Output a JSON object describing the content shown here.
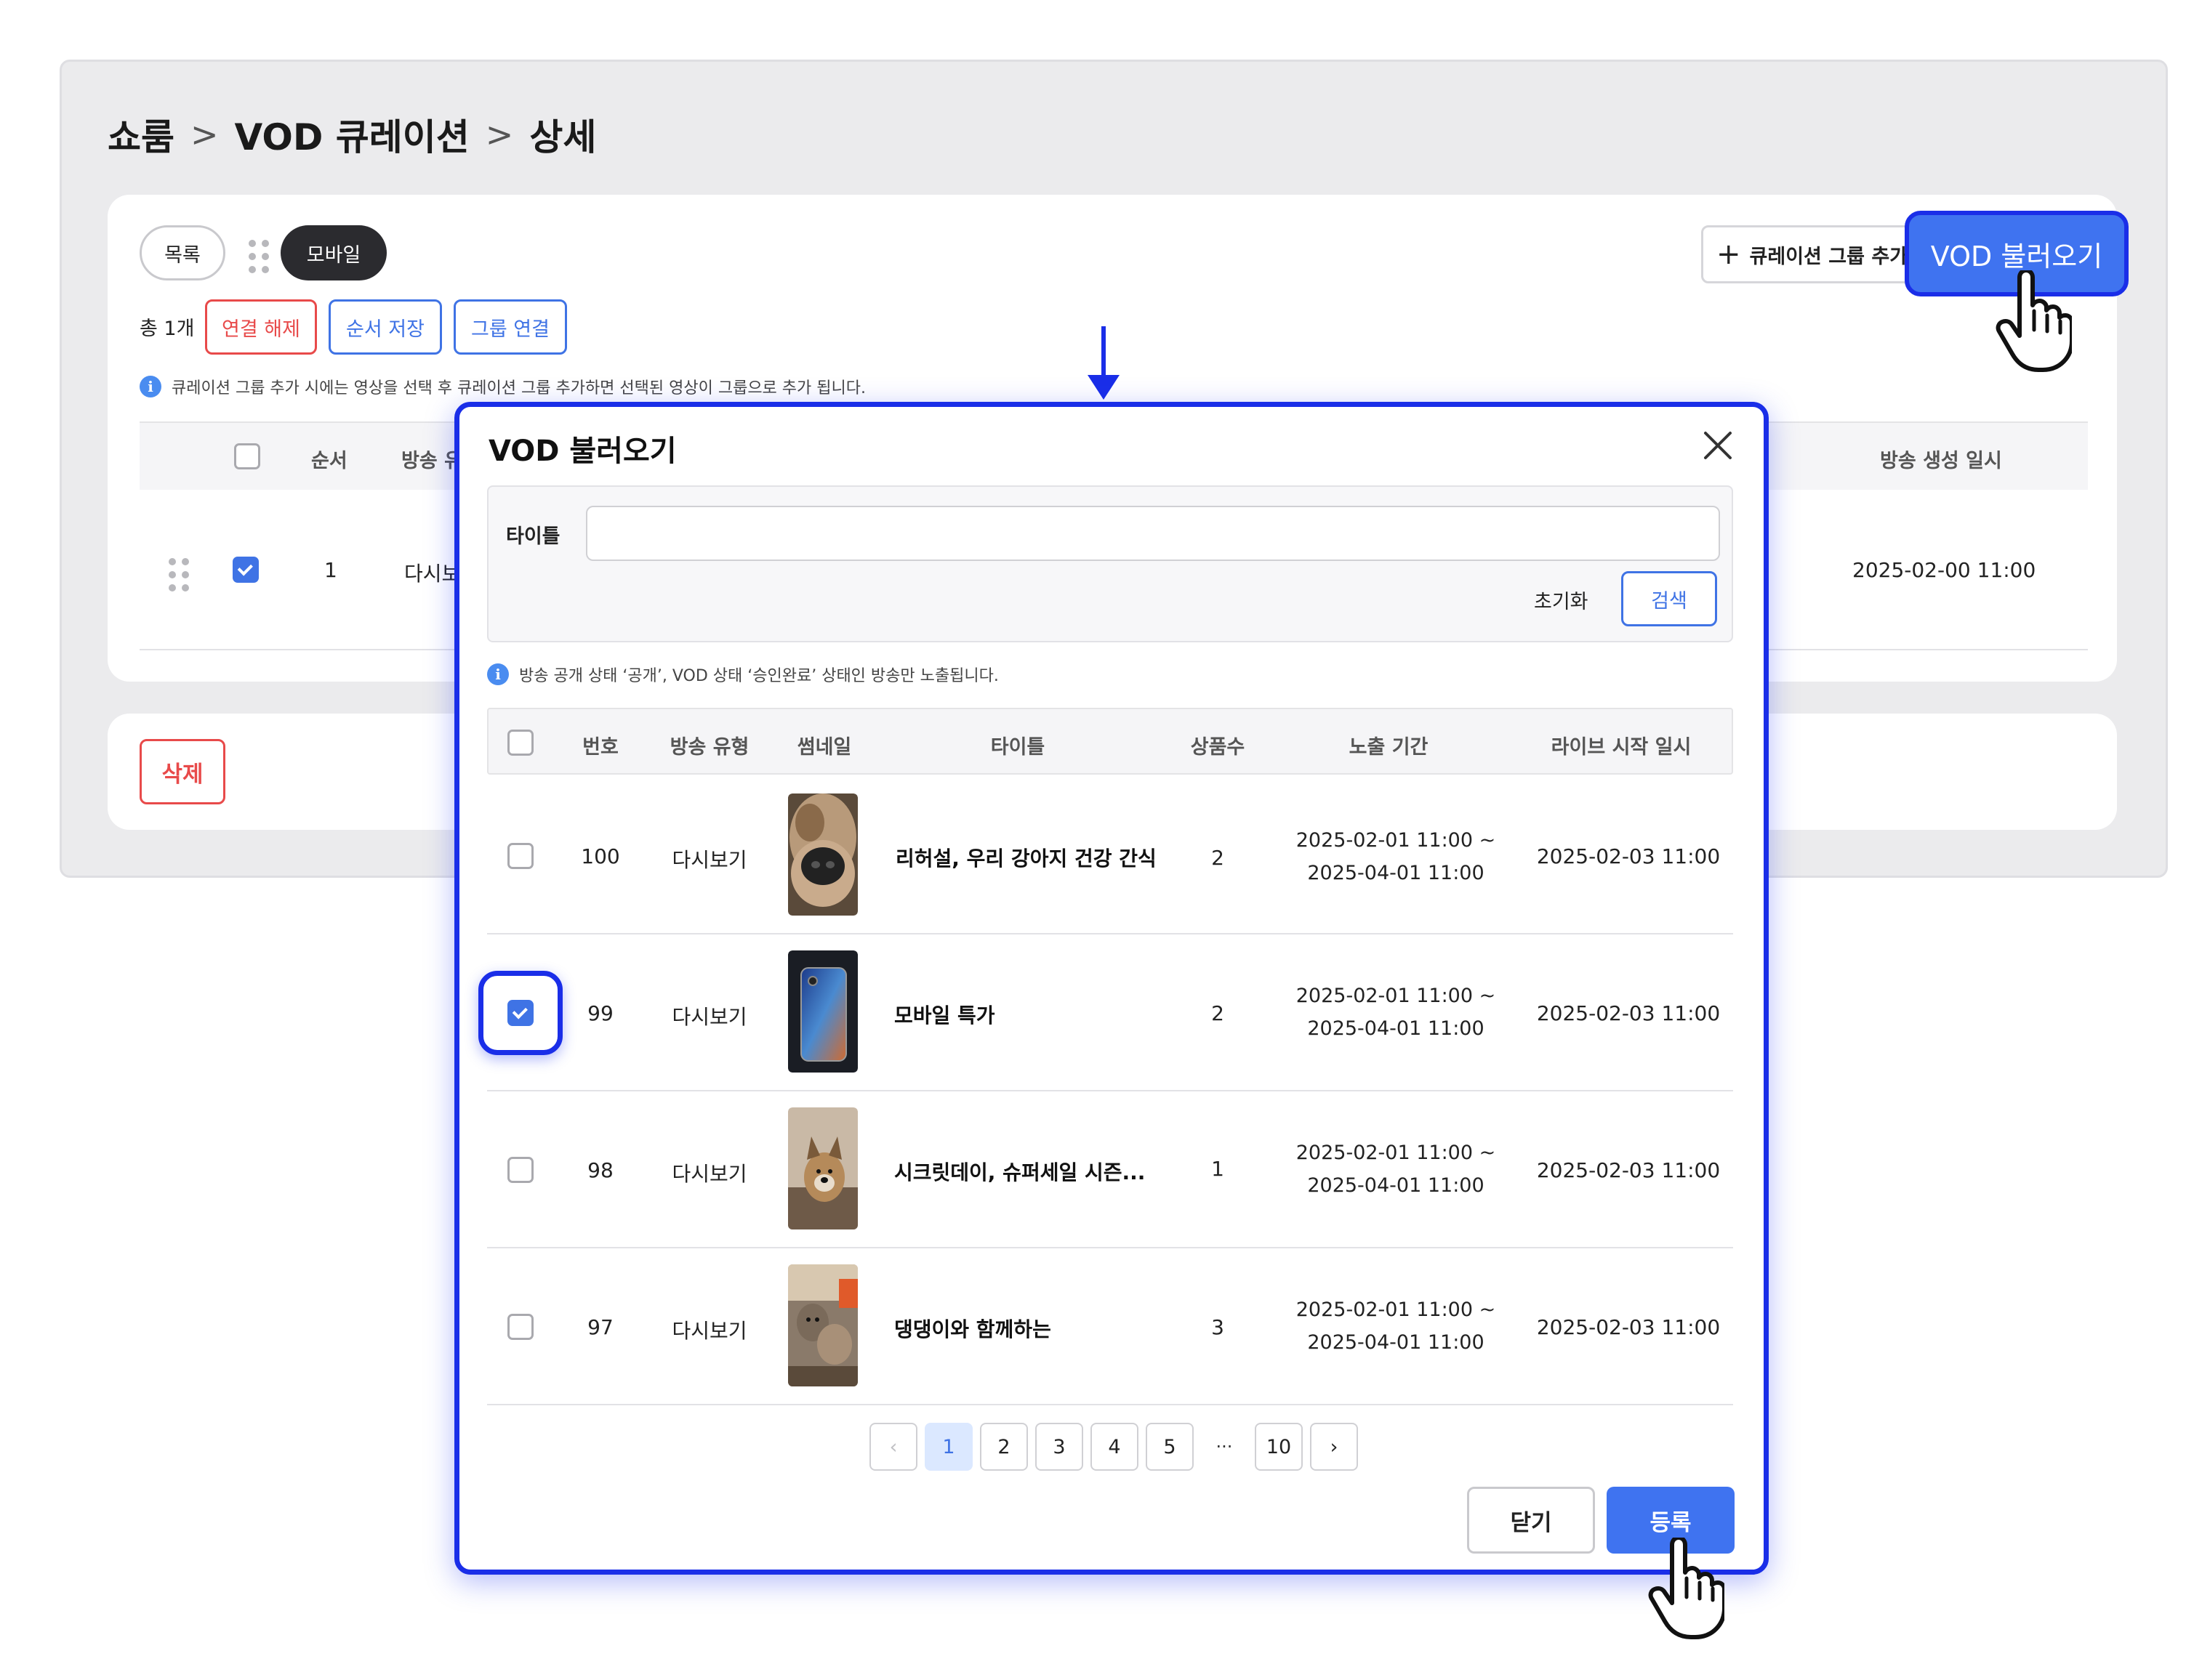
{
  "breadcrumb": {
    "items": [
      "쇼룸",
      "VOD 큐레이션",
      "상세"
    ],
    "separator": ">"
  },
  "tabs": {
    "list_label": "목록",
    "mobile_label": "모바일"
  },
  "toolbar": {
    "total": "총 1개",
    "unlink": "연결 해제",
    "save_order": "순서 저장",
    "group_link": "그룹 연결",
    "add_group": "큐레이션 그룹 추가",
    "vod_load": "VOD 불러오기"
  },
  "info": {
    "text": "큐레이션 그룹 추가 시에는 영상을 선택 후 큐레이션 그룹 추가하면 선택된 영상이 그룹으로 추가 됩니다."
  },
  "main_table": {
    "headers": {
      "order": "순서",
      "type": "방송 유",
      "created": "방송 생성 일시"
    },
    "row": {
      "order": "1",
      "type": "다시보",
      "created": "2025-02-00 11:00"
    }
  },
  "delete_button": "삭제",
  "modal": {
    "title": "VOD 불러오기",
    "search_label": "타이틀",
    "search_value": "",
    "reset": "초기화",
    "search": "검색",
    "notice": "방송 공개 상태 ‘공개’, VOD 상태 ‘승인완료’ 상태인 방송만 노출됩니다.",
    "headers": [
      "번호",
      "방송 유형",
      "썸네일",
      "타이틀",
      "상품수",
      "노출 기간",
      "라이브 시작 일시"
    ],
    "rows": [
      {
        "no": "100",
        "type": "다시보기",
        "thumb": "dog-nose",
        "title": "리허설, 우리 강아지 건강 간식",
        "count": "2",
        "period_start": "2025-02-01 11:00 ~",
        "period_end": "2025-04-01 11:00",
        "live": "2025-02-03 11:00",
        "checked": false
      },
      {
        "no": "99",
        "type": "다시보기",
        "thumb": "smartphone",
        "title": "모바일 특가",
        "count": "2",
        "period_start": "2025-02-01 11:00 ~",
        "period_end": "2025-04-01 11:00",
        "live": "2025-02-03 11:00",
        "checked": true
      },
      {
        "no": "98",
        "type": "다시보기",
        "thumb": "puppy",
        "title": "시크릿데이, 슈퍼세일 시즌...",
        "count": "1",
        "period_start": "2025-02-01 11:00 ~",
        "period_end": "2025-04-01 11:00",
        "live": "2025-02-03 11:00",
        "checked": false
      },
      {
        "no": "97",
        "type": "다시보기",
        "thumb": "dogs",
        "title": "댕댕이와 함께하는",
        "count": "3",
        "period_start": "2025-02-01 11:00 ~",
        "period_end": "2025-04-01 11:00",
        "live": "2025-02-03 11:00",
        "checked": false
      }
    ],
    "pagination": {
      "pages": [
        "1",
        "2",
        "3",
        "4",
        "5"
      ],
      "ellipsis": "···",
      "last": "10",
      "current": "1",
      "prev": "‹",
      "next": "›"
    },
    "close": "닫기",
    "register": "등록"
  },
  "colors": {
    "accent": "#3f73f0",
    "highlight": "#1a2ee8",
    "danger": "#e84a4a"
  }
}
